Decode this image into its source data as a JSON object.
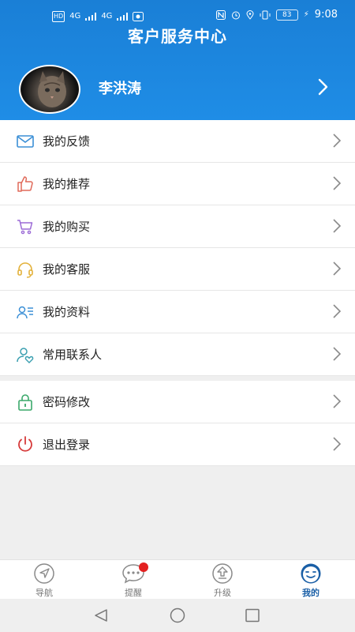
{
  "status_bar": {
    "left_items": [
      "HD",
      "4G",
      "4G"
    ],
    "battery": "83",
    "time": "9:08"
  },
  "header": {
    "title": "客户服务中心",
    "username": "李洪涛"
  },
  "menu": {
    "group1": [
      {
        "label": "我的反馈",
        "icon": "mail-icon",
        "color": "#3b8fd6"
      },
      {
        "label": "我的推荐",
        "icon": "thumbs-up-icon",
        "color": "#e06a5a"
      },
      {
        "label": "我的购买",
        "icon": "cart-icon",
        "color": "#9b6ad6"
      },
      {
        "label": "我的客服",
        "icon": "headset-icon",
        "color": "#e3b13a"
      },
      {
        "label": "我的资料",
        "icon": "profile-card-icon",
        "color": "#3b8fd6"
      },
      {
        "label": "常用联系人",
        "icon": "contacts-icon",
        "color": "#3a9fb0"
      }
    ],
    "group2": [
      {
        "label": "密码修改",
        "icon": "lock-icon",
        "color": "#3aa86a"
      },
      {
        "label": "退出登录",
        "icon": "power-icon",
        "color": "#d63a3a"
      }
    ]
  },
  "tabbar": {
    "items": [
      {
        "label": "导航",
        "icon": "navigation-icon"
      },
      {
        "label": "提醒",
        "icon": "chat-bubble-icon",
        "badge": true
      },
      {
        "label": "升级",
        "icon": "upgrade-icon"
      },
      {
        "label": "我的",
        "icon": "smiley-icon",
        "active": true
      }
    ]
  },
  "colors": {
    "primary": "#1f8de6",
    "active_tab": "#1a5fa6",
    "badge": "#e32020"
  }
}
